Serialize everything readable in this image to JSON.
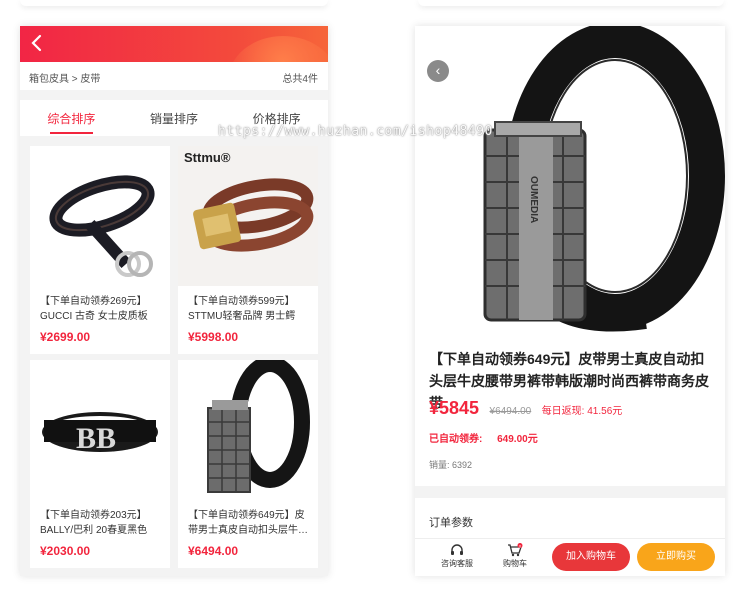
{
  "left": {
    "breadcrumb": "箱包皮具 > 皮带",
    "total": "总共4件",
    "tabs": [
      "综合排序",
      "销量排序",
      "价格排序"
    ],
    "products": [
      {
        "title": "【下单自动领券269元】GUCCI 古奇 女士皮质板扣…",
        "price": "¥2699.00",
        "brand": ""
      },
      {
        "title": "【下单自动领券599元】STTMU轻奢品牌 男士鳄鱼…",
        "price": "¥5998.00",
        "brand": "Sttmu®"
      },
      {
        "title": "【下单自动领券203元】BALLY/巴利 20春夏黑色拼…",
        "price": "¥2030.00",
        "brand": ""
      },
      {
        "title": "【下单自动领券649元】皮带男士真皮自动扣头层牛…",
        "price": "¥6494.00",
        "brand": ""
      }
    ]
  },
  "right": {
    "title": "【下单自动领券649元】皮带男士真皮自动扣头层牛皮腰带男裤带韩版潮时尚西裤带商务皮带",
    "price": "¥5845",
    "original_price": "¥6494.00",
    "rebate": "每日返现: 41.56元",
    "coupon_label": "已自动领券:",
    "coupon_amount": "649.00元",
    "sales": "销量: 6392",
    "params_label": "订单参数",
    "service_label": "咨询客服",
    "cart_label": "购物车",
    "cart_badge": "0",
    "add_cart": "加入购物车",
    "buy_now": "立即购买",
    "buckle_text": "OUMEDIA"
  },
  "watermark": "https://www.huzhan.com/ishop48490",
  "colors": {
    "accent": "#f2253d",
    "buy": "#f9a51a",
    "cart_btn": "#e8373a"
  }
}
